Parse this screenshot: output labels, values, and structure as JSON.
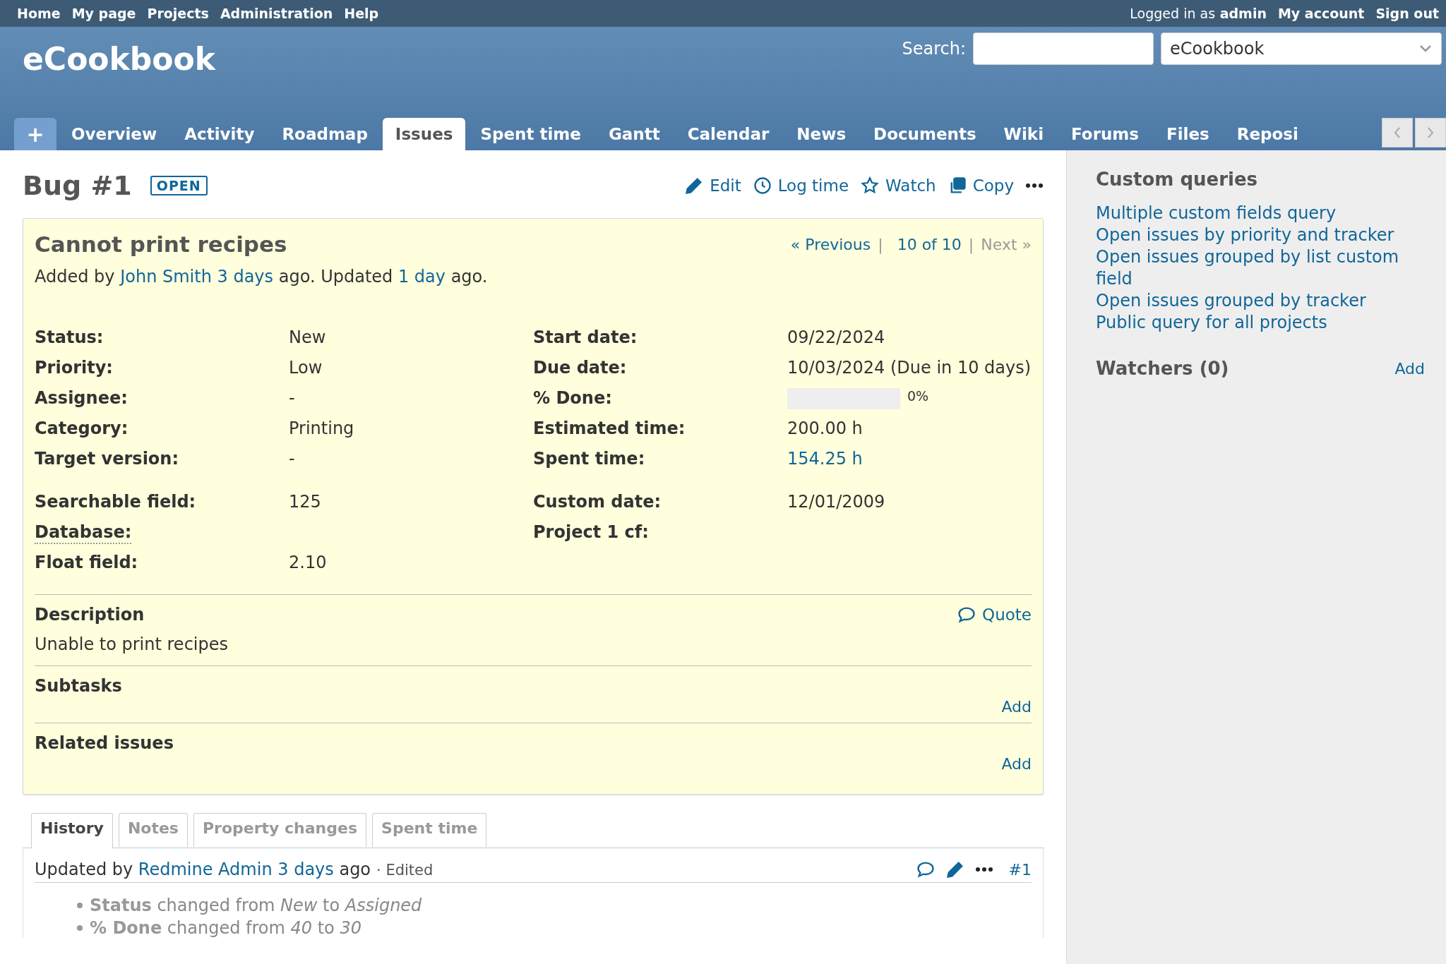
{
  "top_menu": [
    "Home",
    "My page",
    "Projects",
    "Administration",
    "Help"
  ],
  "account": {
    "prefix": "Logged in as",
    "user": "admin",
    "links": [
      "My account",
      "Sign out"
    ]
  },
  "header": {
    "title": "eCookbook",
    "search_label": "Search:",
    "project_select": "eCookbook"
  },
  "new_button": "+",
  "main_tabs": [
    {
      "label": "Overview",
      "selected": false
    },
    {
      "label": "Activity",
      "selected": false
    },
    {
      "label": "Roadmap",
      "selected": false
    },
    {
      "label": "Issues",
      "selected": true
    },
    {
      "label": "Spent time",
      "selected": false
    },
    {
      "label": "Gantt",
      "selected": false
    },
    {
      "label": "Calendar",
      "selected": false
    },
    {
      "label": "News",
      "selected": false
    },
    {
      "label": "Documents",
      "selected": false
    },
    {
      "label": "Wiki",
      "selected": false
    },
    {
      "label": "Forums",
      "selected": false
    },
    {
      "label": "Files",
      "selected": false
    },
    {
      "label": "Reposi",
      "selected": false
    }
  ],
  "issue": {
    "heading": "Bug #1",
    "status_badge": "OPEN",
    "actions": [
      {
        "kind": "edit",
        "label": "Edit"
      },
      {
        "kind": "log",
        "label": "Log time"
      },
      {
        "kind": "watch",
        "label": "Watch"
      },
      {
        "kind": "copy",
        "label": "Copy"
      },
      {
        "kind": "more"
      }
    ],
    "subject": "Cannot print recipes",
    "nav": {
      "previous": "« Previous",
      "separator": "|",
      "counter": "10 of 10",
      "next": "Next »",
      "next_disabled": true
    },
    "meta": [
      {
        "text": "Added by "
      },
      {
        "text": "John Smith",
        "link": true
      },
      {
        "text": "3 days",
        "link": true
      },
      {
        "text": " ago. Updated "
      },
      {
        "text": "1 day",
        "link": true
      },
      {
        "text": " ago."
      }
    ],
    "attribute_groups": [
      {
        "left": [
          {
            "label": "Status:",
            "value": "New"
          },
          {
            "label": "Priority:",
            "value": "Low"
          },
          {
            "label": "Assignee:",
            "value": "-"
          },
          {
            "label": "Category:",
            "value": "Printing"
          },
          {
            "label": "Target version:",
            "value": "-"
          }
        ],
        "right": [
          {
            "label": "Start date:",
            "value": "09/22/2024"
          },
          {
            "label": "Due date:",
            "value": "10/03/2024 (Due in 10 days)"
          },
          {
            "label": "% Done:",
            "kind": "progress",
            "level": 0,
            "reading": "0%"
          },
          {
            "label": "Estimated time:",
            "value": "200.00 h"
          },
          {
            "label": "Spent time:",
            "value": "154.25 h",
            "link": true
          }
        ]
      },
      {
        "left": [
          {
            "label": "Searchable field:",
            "value": "125"
          },
          {
            "label": "Database:",
            "hint": true
          },
          {
            "label": "Float field:",
            "value": "2.10"
          }
        ],
        "right": [
          {
            "label": "Custom date:",
            "value": "12/01/2009"
          },
          {
            "label": "Project 1 cf:"
          }
        ]
      }
    ],
    "description": {
      "heading": "Description",
      "quote": "Quote",
      "text": "Unable to print recipes"
    },
    "sections": [
      {
        "heading": "Subtasks",
        "action": "Add"
      },
      {
        "heading": "Related issues",
        "action": "Add"
      }
    ]
  },
  "history_tabs": [
    {
      "label": "History",
      "selected": true
    },
    {
      "label": "Notes",
      "selected": false
    },
    {
      "label": "Property changes",
      "selected": false
    },
    {
      "label": "Spent time",
      "selected": false
    }
  ],
  "journal": {
    "header": [
      {
        "text": "Updated by "
      },
      {
        "text": "Redmine Admin",
        "link": true
      },
      {
        "text": "3 days",
        "link": true
      },
      {
        "text": " ago"
      }
    ],
    "edited": "· Edited",
    "number": "#1",
    "details": [
      "**Status** changed from *New* to *Assigned*",
      "**% Done** changed from *40* to *30*"
    ]
  },
  "sidebar": {
    "queries_heading": "Custom queries",
    "queries": [
      "Multiple custom fields query",
      "Open issues by priority and tracker",
      "Open issues grouped by list custom field",
      "Open issues grouped by tracker",
      "Public query for all projects"
    ],
    "watchers_heading": "Watchers (0)",
    "watchers_add": "Add"
  }
}
